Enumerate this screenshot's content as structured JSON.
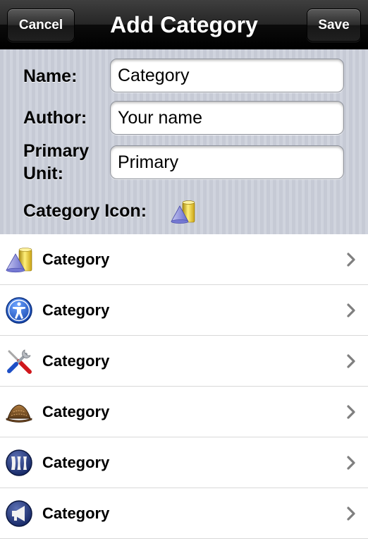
{
  "navbar": {
    "cancel_label": "Cancel",
    "title": "Add Category",
    "save_label": "Save"
  },
  "form": {
    "name_label": "Name:",
    "name_value": "Category",
    "author_label": "Author:",
    "author_placeholder": "Your name",
    "primary_unit_label_line1": "Primary",
    "primary_unit_label_line2": "Unit:",
    "primary_unit_placeholder": "Primary",
    "category_icon_label": "Category Icon:",
    "category_icon": "shapes-icon"
  },
  "list": {
    "items": [
      {
        "label": "Category",
        "icon": "shapes-icon"
      },
      {
        "label": "Category",
        "icon": "accessibility-icon"
      },
      {
        "label": "Category",
        "icon": "tools-icon"
      },
      {
        "label": "Category",
        "icon": "detective-hat-icon"
      },
      {
        "label": "Category",
        "icon": "columns-icon"
      },
      {
        "label": "Category",
        "icon": "megaphone-icon"
      }
    ]
  },
  "colors": {
    "navbar_top": "#3f3f3f",
    "navbar_bottom": "#000000",
    "form_background": "#c8ccd7",
    "separator": "#d9d9d9",
    "chevron": "#7f7f7f"
  }
}
